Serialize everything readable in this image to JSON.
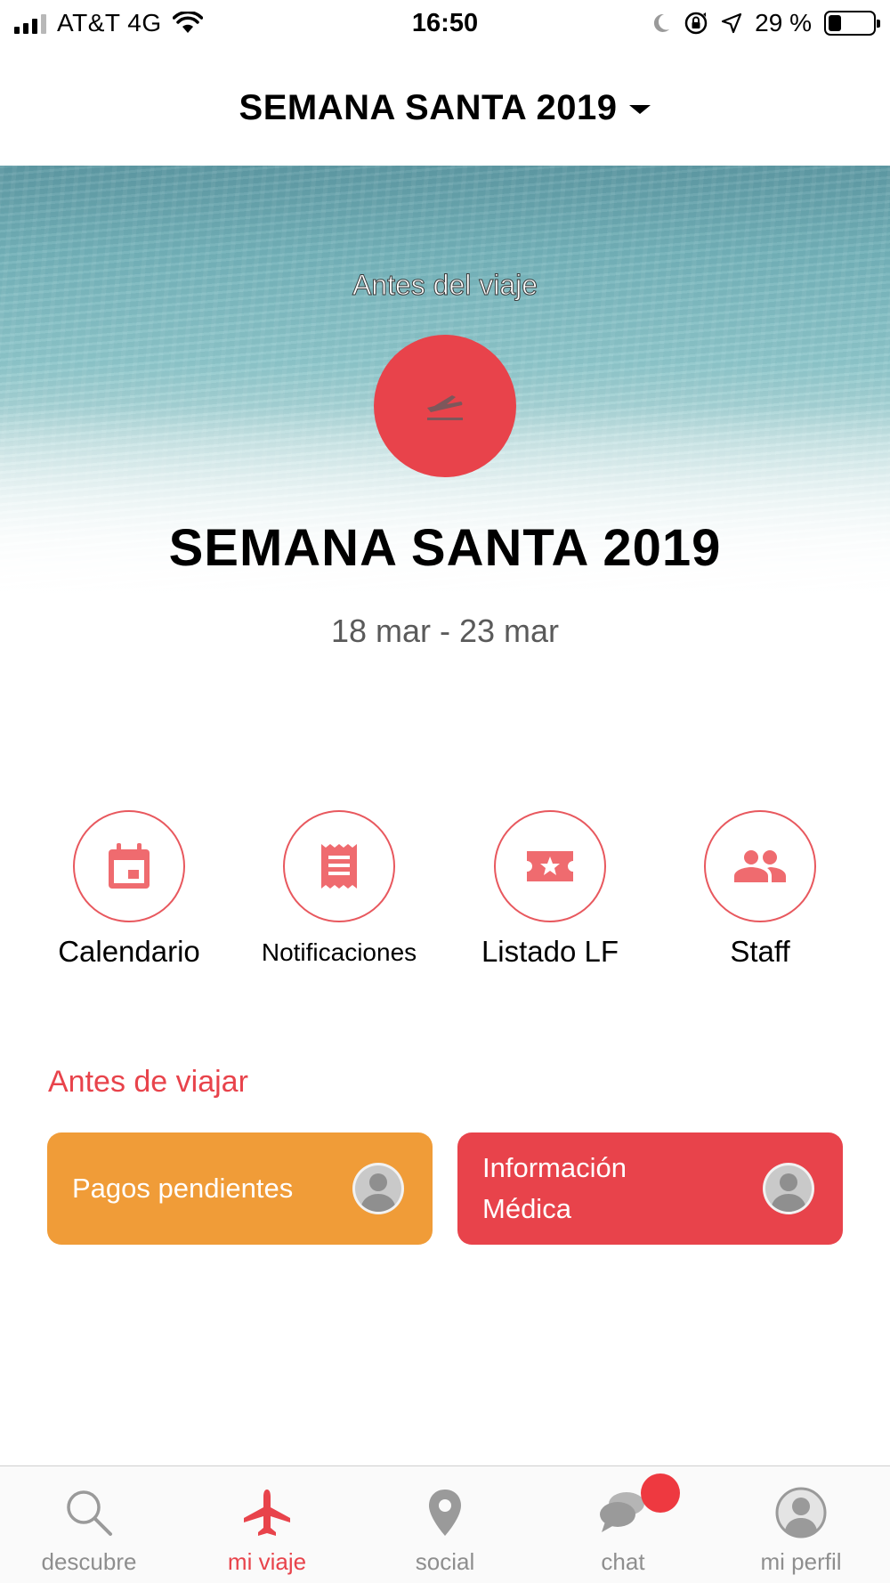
{
  "status_bar": {
    "carrier": "AT&T 4G",
    "time": "16:50",
    "battery_percent": "29 %",
    "battery_level": 0.29,
    "icons": [
      "signal-icon",
      "wifi-icon",
      "moon-icon",
      "orientation-lock-icon",
      "location-arrow-icon",
      "battery-icon"
    ]
  },
  "header": {
    "title": "SEMANA SANTA 2019",
    "dropdown_icon": "caret-down-icon"
  },
  "hero": {
    "subtitle": "Antes del viaje",
    "icon": "plane-departure-icon",
    "title": "SEMANA SANTA 2019",
    "dates": "18 mar - 23 mar"
  },
  "shortcuts": [
    {
      "label": "Calendario",
      "icon": "calendar-icon"
    },
    {
      "label": "Notificaciones",
      "icon": "receipt-icon"
    },
    {
      "label": "Listado LF",
      "icon": "ticket-star-icon"
    },
    {
      "label": "Staff",
      "icon": "people-icon"
    }
  ],
  "before_travel": {
    "title": "Antes de viajar",
    "cards": [
      {
        "label": "Pagos pendientes",
        "color": "#f09c38"
      },
      {
        "label_line1": "Información",
        "label_line2": "Médica",
        "color": "#e8434b"
      }
    ]
  },
  "tabbar": {
    "tabs": [
      {
        "label": "descubre",
        "icon": "search-icon"
      },
      {
        "label": "mi viaje",
        "icon": "airplane-icon",
        "active": true
      },
      {
        "label": "social",
        "icon": "map-pin-icon"
      },
      {
        "label": "chat",
        "icon": "chat-bubbles-icon",
        "badge": true
      },
      {
        "label": "mi perfil",
        "icon": "profile-icon"
      }
    ]
  },
  "colors": {
    "accent_red": "#e8434b",
    "accent_orange": "#f09c38",
    "inactive_gray": "#8e8e8e"
  }
}
